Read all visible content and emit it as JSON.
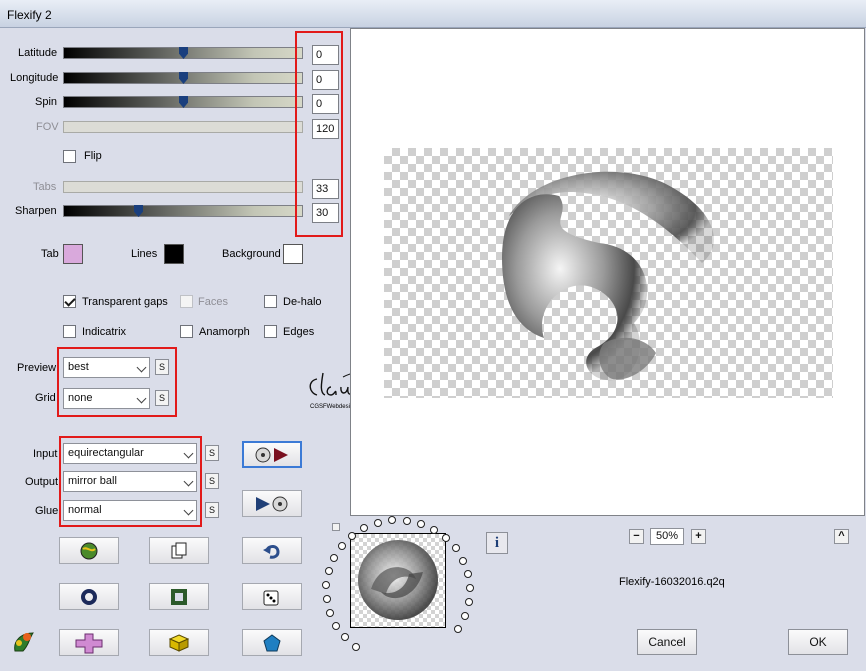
{
  "window": {
    "title": "Flexify 2"
  },
  "sliders": {
    "latitude": {
      "label": "Latitude",
      "value": "0"
    },
    "longitude": {
      "label": "Longitude",
      "value": "0"
    },
    "spin": {
      "label": "Spin",
      "value": "0"
    },
    "fov": {
      "label": "FOV",
      "value": "120"
    },
    "tabs": {
      "label": "Tabs",
      "value": "33"
    },
    "sharpen": {
      "label": "Sharpen",
      "value": "30"
    }
  },
  "flip": {
    "label": "Flip",
    "checked": false
  },
  "colors": {
    "tab": {
      "label": "Tab",
      "color": "#d9a9dc"
    },
    "lines": {
      "label": "Lines",
      "color": "#000000"
    },
    "background": {
      "label": "Background",
      "color": "#ffffff"
    }
  },
  "options": {
    "transparent_gaps": {
      "label": "Transparent gaps",
      "checked": true
    },
    "faces": {
      "label": "Faces",
      "checked": false
    },
    "de_halo": {
      "label": "De-halo",
      "checked": false
    },
    "indicatrix": {
      "label": "Indicatrix",
      "checked": false
    },
    "anamorph": {
      "label": "Anamorph",
      "checked": false
    },
    "edges": {
      "label": "Edges",
      "checked": false
    }
  },
  "preview": {
    "label": "Preview",
    "value": "best"
  },
  "grid": {
    "label": "Grid",
    "value": "none"
  },
  "input": {
    "label": "Input",
    "value": "equirectangular"
  },
  "output": {
    "label": "Output",
    "value": "mirror ball"
  },
  "glue": {
    "label": "Glue",
    "value": "normal"
  },
  "s_button_label": "S",
  "watermark": {
    "name": "claudia",
    "sub": "CGSFWebdesign"
  },
  "zoom": {
    "value": "50%",
    "minus": "−",
    "plus": "+",
    "up": "^"
  },
  "info_label": "i",
  "filename": "Flexify-16032016.q2q",
  "buttons": {
    "cancel": "Cancel",
    "ok": "OK"
  }
}
